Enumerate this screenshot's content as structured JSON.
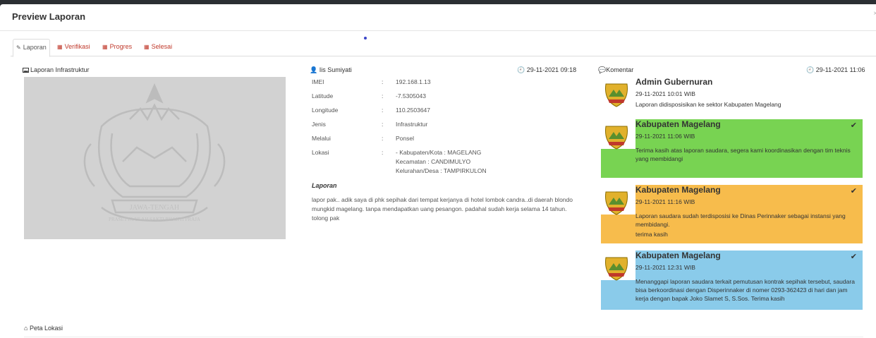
{
  "modal": {
    "title": "Preview Laporan"
  },
  "tabs": [
    {
      "label": "Laporan",
      "icon": "pencil-icon"
    },
    {
      "label": "Verifikasi",
      "icon": "table-icon"
    },
    {
      "label": "Progres",
      "icon": "table-icon"
    },
    {
      "label": "Selesai",
      "icon": "table-icon"
    }
  ],
  "left": {
    "section_label": "Laporan Infrastruktur",
    "emblem_text": "JAWA-TENGAH",
    "emblem_motto": "PRASETYA ULAH SAKTI BHAKTI PRAJA"
  },
  "middle": {
    "reporter": "Iis Sumiyati",
    "datetime": "29-11-2021 09:18",
    "fields": [
      {
        "key": "IMEI",
        "value": "192.168.1.13"
      },
      {
        "key": "Latitude",
        "value": "-7.5305043"
      },
      {
        "key": "Longitude",
        "value": "110.2503647"
      },
      {
        "key": "Jenis",
        "value": "Infrastruktur"
      },
      {
        "key": "Melalui",
        "value": "Ponsel"
      },
      {
        "key": "Lokasi",
        "value": "- Kabupaten/Kota : MAGELANG",
        "value2": "Kecamatan : CANDIMULYO",
        "value3": "Kelurahan/Desa : TAMPIRKULON"
      }
    ],
    "separator": ":",
    "laporan_heading": "Laporan",
    "laporan_text": "lapor pak.. adik saya di phk sepihak dari tempat kerjanya di hotel lombok candra..di daerah blondo mungkid magelang. tanpa mendapatkan uang pesangon. padahal sudah kerja selama 14 tahun. tolong pak"
  },
  "comments_panel": {
    "label": "Komentar",
    "datetime": "29-11-2021 11:06",
    "items": [
      {
        "name": "Admin Gubernuran",
        "date": "29-11-2021 10:01 WIB",
        "message": "Laporan didisposisikan ke sektor Kabupaten Magelang",
        "color": "#ffffff"
      },
      {
        "name": "Kabupaten Magelang",
        "date": "29-11-2021 11:06 WIB",
        "message": "Terima kasih atas laporan saudara, segera kami koordinasikan dengan tim teknis yang membidangi",
        "color": "#78d352"
      },
      {
        "name": "Kabupaten Magelang",
        "date": "29-11-2021 11:16 WIB",
        "message": "Laporan saudara sudah terdisposisi ke Dinas Perinnaker sebagai instansi yang membidangi.",
        "message2": "terima kasih",
        "color": "#f7bc4c"
      },
      {
        "name": "Kabupaten Magelang",
        "date": "29-11-2021 12:31 WIB",
        "message": "Menanggapi laporan saudara terkait pemutusan kontrak sepihak tersebut, saudara bisa berkoordinasi dengan Disperinnaker di nomer 0293-362423 di hari dan jam kerja dengan bapak Joko Slamet S, S.Sos. Terima kasih",
        "color": "#8acbea"
      }
    ]
  },
  "map": {
    "label": "Peta Lokasi"
  }
}
